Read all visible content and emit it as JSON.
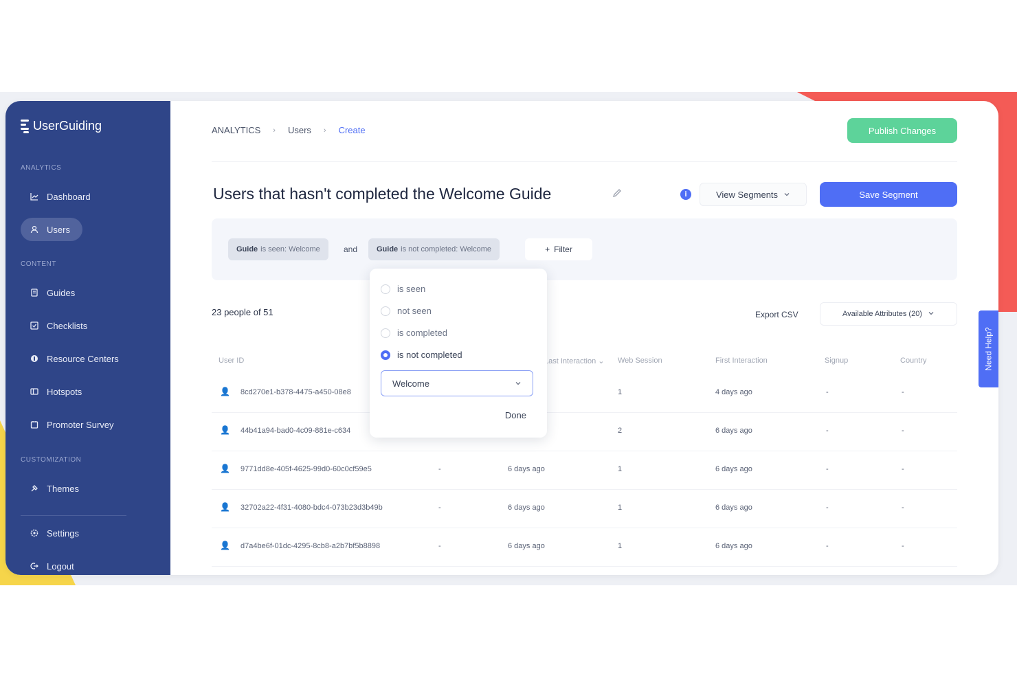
{
  "brand": {
    "name": "UserGuiding"
  },
  "sidebar": {
    "sections": [
      "ANALYTICS",
      "CONTENT",
      "CUSTOMIZATION"
    ],
    "items": [
      {
        "label": "Dashboard",
        "icon": "chart-line-icon"
      },
      {
        "label": "Users",
        "icon": "user-icon",
        "active": true
      },
      {
        "label": "Guides",
        "icon": "guide-icon"
      },
      {
        "label": "Checklists",
        "icon": "checklist-icon"
      },
      {
        "label": "Resource Centers",
        "icon": "resource-center-icon"
      },
      {
        "label": "Hotspots",
        "icon": "hotspot-icon"
      },
      {
        "label": "Promoter Survey",
        "icon": "survey-icon"
      },
      {
        "label": "Themes",
        "icon": "palette-icon"
      },
      {
        "label": "Settings",
        "icon": "gear-icon"
      },
      {
        "label": "Logout",
        "icon": "logout-icon"
      }
    ]
  },
  "breadcrumb": [
    "ANALYTICS",
    "Users",
    "Create"
  ],
  "header": {
    "publish_label": "Publish Changes",
    "title": "Users that hasn't completed the Welcome Guide",
    "view_segments_label": "View Segments",
    "save_segment_label": "Save Segment"
  },
  "filters": {
    "chip1": {
      "key": "Guide",
      "text": "is seen: Welcome"
    },
    "connector": "and",
    "chip2": {
      "key": "Guide",
      "text": "is not completed: Welcome"
    },
    "add_filter_label": "Filter"
  },
  "dropdown": {
    "options": [
      "is seen",
      "not seen",
      "is completed",
      "is not completed"
    ],
    "selected_index": 3,
    "select_value": "Welcome",
    "done_label": "Done"
  },
  "table": {
    "people_count": "23 people of 51",
    "export_label": "Export CSV",
    "attributes_label": "Available Attributes (20)",
    "columns": [
      "User ID",
      "",
      "Last Interaction",
      "Web Session",
      "First Interaction",
      "Signup",
      "Country"
    ],
    "rows": [
      {
        "id": "8cd270e1-b378-4475-a450-08e8",
        "email": "",
        "last": "",
        "sessions": "1",
        "first": "4 days ago",
        "signup": "-",
        "country": "-"
      },
      {
        "id": "44b41a94-bad0-4c09-881e-c634",
        "email": "",
        "last": "",
        "sessions": "2",
        "first": "6 days ago",
        "signup": "-",
        "country": "-"
      },
      {
        "id": "9771dd8e-405f-4625-99d0-60c0cf59e5",
        "email": "-",
        "last": "6 days ago",
        "sessions": "1",
        "first": "6 days ago",
        "signup": "-",
        "country": "-"
      },
      {
        "id": "32702a22-4f31-4080-bdc4-073b23d3b49b",
        "email": "-",
        "last": "6 days ago",
        "sessions": "1",
        "first": "6 days ago",
        "signup": "-",
        "country": "-"
      },
      {
        "id": "d7a4be6f-01dc-4295-8cb8-a2b7bf5b8898",
        "email": "-",
        "last": "6 days ago",
        "sessions": "1",
        "first": "6 days ago",
        "signup": "-",
        "country": "-"
      }
    ]
  },
  "help": {
    "label": "Need Help?"
  },
  "colors": {
    "sidebar": "#2f4588",
    "primary": "#4f6ef5",
    "publish": "#5dd39a"
  }
}
